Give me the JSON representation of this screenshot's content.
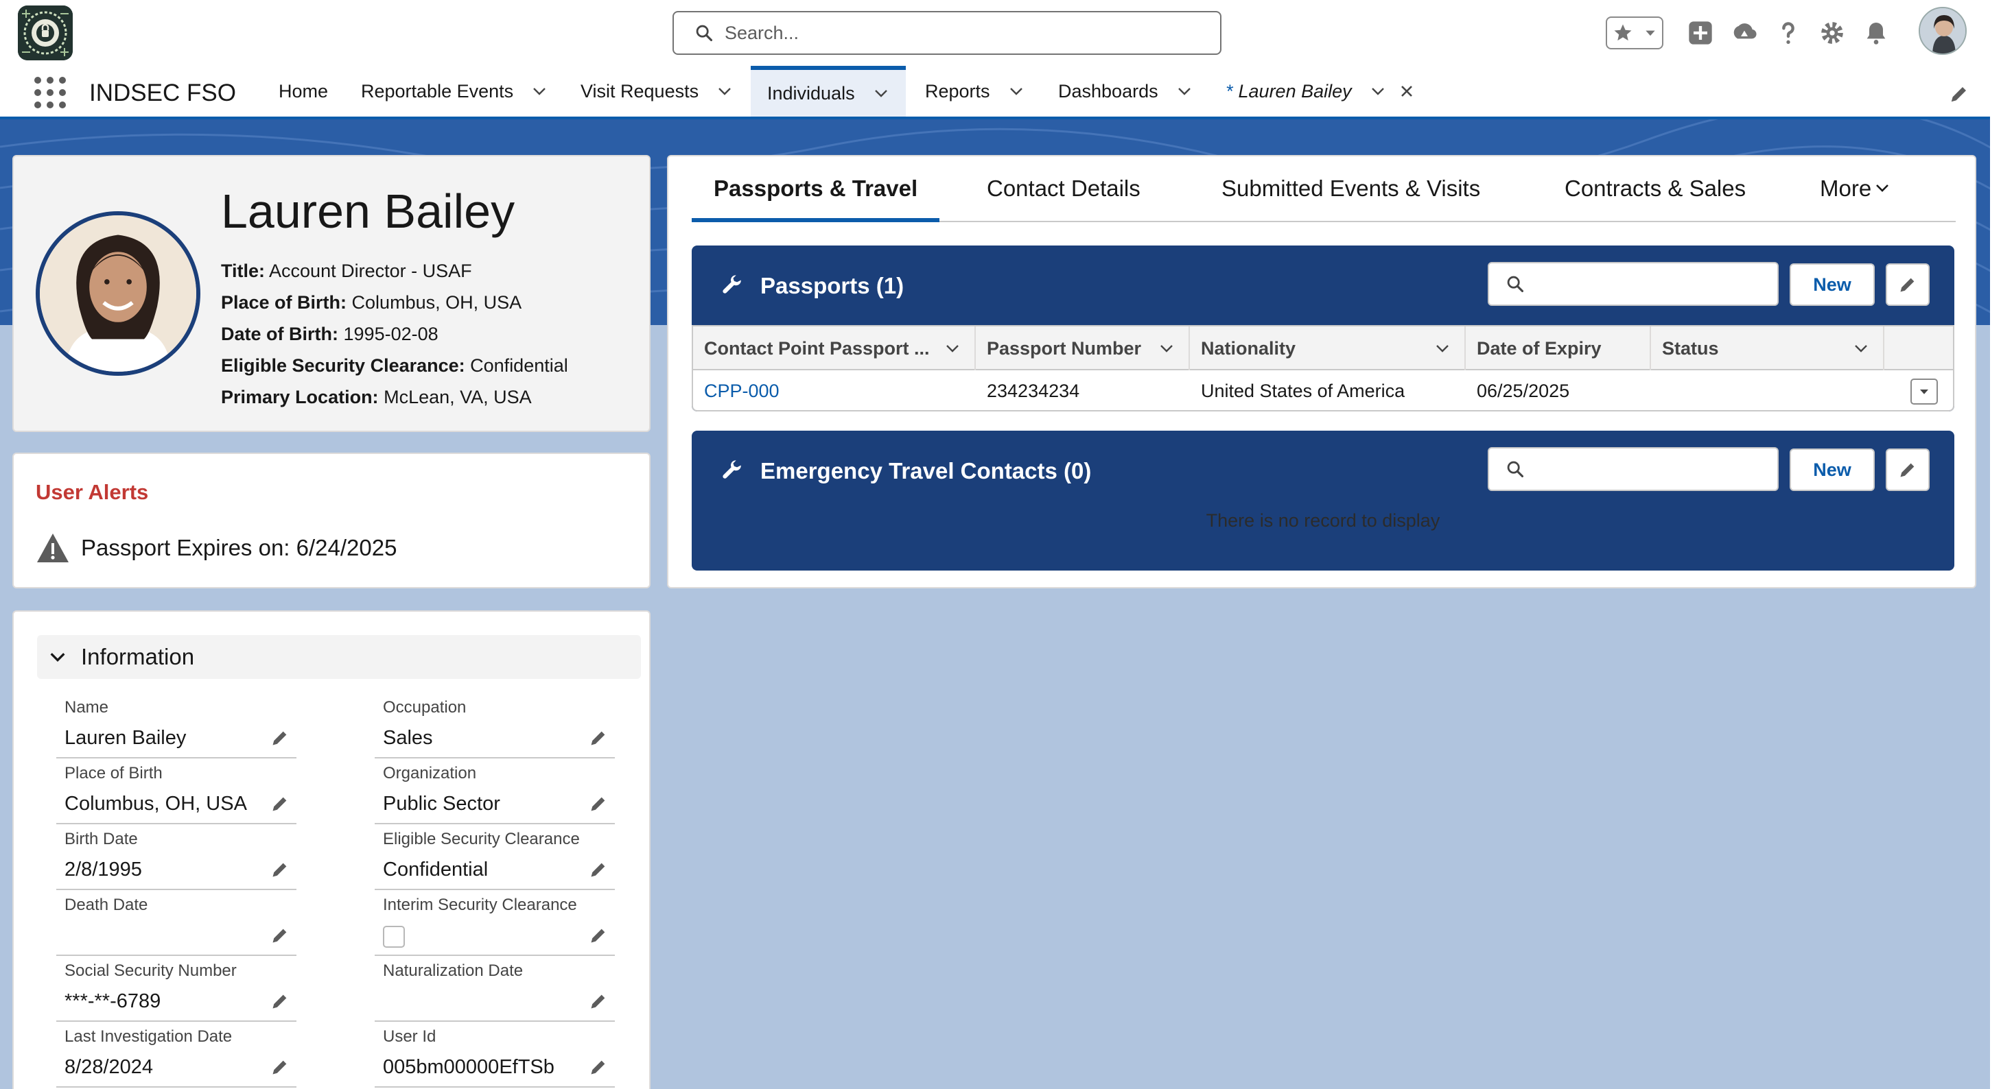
{
  "header": {
    "app_name": "INDSEC FSO",
    "search_placeholder": "Search..."
  },
  "nav": {
    "items": [
      {
        "label": "Home"
      },
      {
        "label": "Reportable Events"
      },
      {
        "label": "Visit Requests"
      },
      {
        "label": "Individuals"
      },
      {
        "label": "Reports"
      },
      {
        "label": "Dashboards"
      }
    ],
    "record_tab": {
      "prefix": "*",
      "label": "Lauren Bailey"
    }
  },
  "profile": {
    "name": "Lauren Bailey",
    "fields": [
      {
        "label": "Title:",
        "value": "Account Director - USAF"
      },
      {
        "label": "Place of Birth:",
        "value": "Columbus, OH, USA"
      },
      {
        "label": "Date of Birth:",
        "value": "1995-02-08"
      },
      {
        "label": "Eligible Security Clearance:",
        "value": "Confidential"
      },
      {
        "label": "Primary Location:",
        "value": "McLean, VA, USA"
      }
    ]
  },
  "alerts": {
    "title": "User Alerts",
    "message": "Passport Expires on: 6/24/2025"
  },
  "information": {
    "title": "Information",
    "left": [
      {
        "label": "Name",
        "value": "Lauren Bailey"
      },
      {
        "label": "Place of Birth",
        "value": "Columbus, OH, USA"
      },
      {
        "label": "Birth Date",
        "value": "2/8/1995"
      },
      {
        "label": "Death Date",
        "value": ""
      },
      {
        "label": "Social Security Number",
        "value": "***-**-6789"
      },
      {
        "label": "Last Investigation Date",
        "value": "8/28/2024"
      }
    ],
    "right": [
      {
        "label": "Occupation",
        "value": "Sales"
      },
      {
        "label": "Organization",
        "value": "Public Sector"
      },
      {
        "label": "Eligible Security Clearance",
        "value": "Confidential"
      },
      {
        "label": "Interim Security Clearance",
        "value": ""
      },
      {
        "label": "Naturalization Date",
        "value": ""
      },
      {
        "label": "User Id",
        "value": "005bm00000EfTSb"
      }
    ]
  },
  "tabs": {
    "items": [
      {
        "label": "Passports & Travel"
      },
      {
        "label": "Contact Details"
      },
      {
        "label": "Submitted Events & Visits"
      },
      {
        "label": "Contracts & Sales"
      },
      {
        "label": "More"
      }
    ]
  },
  "passports": {
    "title": "Passports (1)",
    "new_label": "New",
    "columns": [
      "Contact Point Passport ...",
      "Passport Number",
      "Nationality",
      "Date of Expiry",
      "Status"
    ],
    "rows": [
      {
        "id": "CPP-000",
        "number": "234234234",
        "nationality": "United States of America",
        "expiry": "06/25/2025",
        "status": ""
      }
    ]
  },
  "emergency": {
    "title": "Emergency Travel Contacts (0)",
    "new_label": "New",
    "empty": "There is no record to display"
  },
  "colors": {
    "brand": "#0b5cab",
    "panel": "#1b3f7a",
    "alert": "#c23934",
    "banner": "#2b5ea6"
  }
}
